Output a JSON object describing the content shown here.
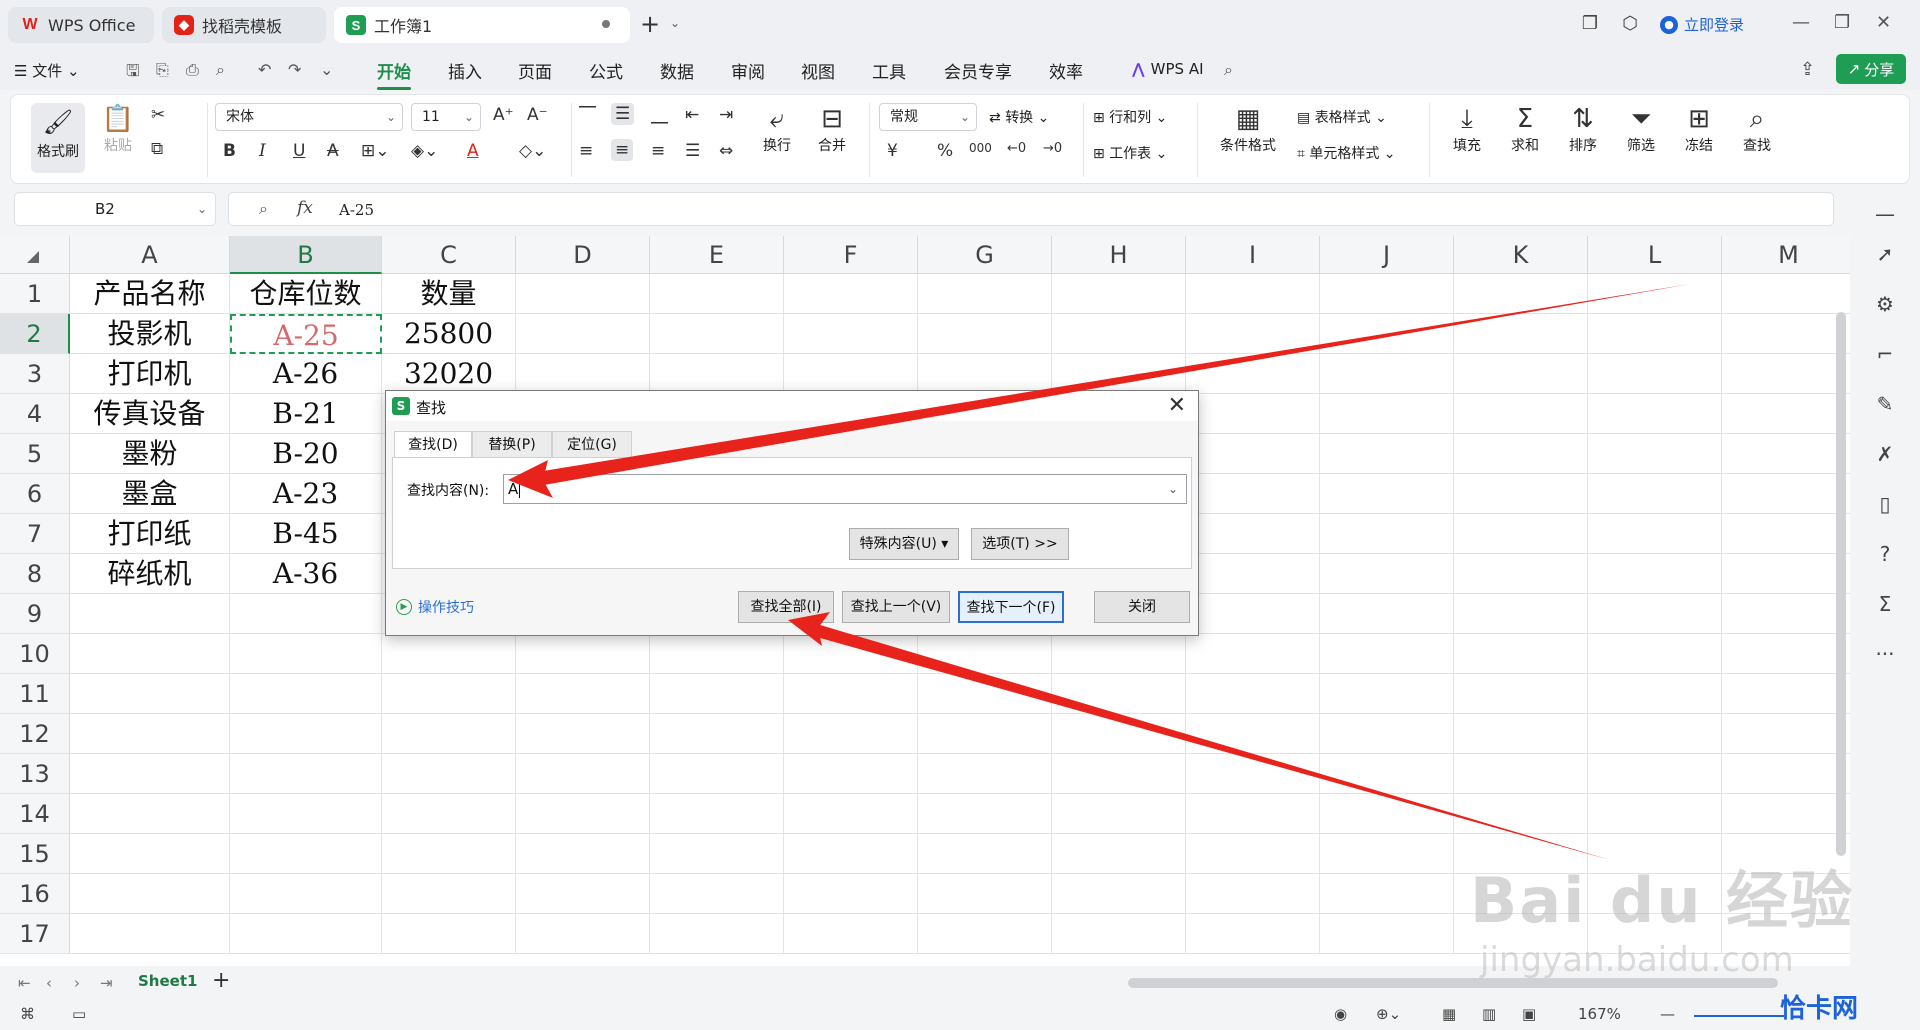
{
  "tabs": {
    "wps": "WPS Office",
    "template": "找稻壳模板",
    "workbook": "工作簿1",
    "wps_logo": "W",
    "sheet_logo": "S"
  },
  "title_bar": {
    "login": "立即登录"
  },
  "menu": {
    "file": "文件",
    "items": [
      "开始",
      "插入",
      "页面",
      "公式",
      "数据",
      "审阅",
      "视图",
      "工具",
      "会员专享",
      "效率"
    ],
    "wps_ai": "WPS AI",
    "share": "分享"
  },
  "ribbon": {
    "format_painter": "格式刷",
    "paste": "粘贴",
    "font_name": "宋体",
    "font_size": "11",
    "wrap": "换行",
    "merge": "合并",
    "number_format": "常规",
    "convert": "转换",
    "row_col": "行和列",
    "worksheet": "工作表",
    "cond_format": "条件格式",
    "table_style": "表格样式",
    "cell_style": "单元格样式",
    "fill": "填充",
    "sum": "求和",
    "sort": "排序",
    "filter": "筛选",
    "freeze": "冻结",
    "find": "查找",
    "bold": "B",
    "italic": "I",
    "underline": "U",
    "font_color": "A",
    "currency": "¥",
    "percent": "%",
    "thousands": "000"
  },
  "formula_bar": {
    "name_box": "B2",
    "fx": "fx",
    "content": "A-25"
  },
  "grid": {
    "columns": [
      "A",
      "B",
      "C",
      "D",
      "E",
      "F",
      "G",
      "H",
      "I",
      "J",
      "K",
      "L",
      "M"
    ],
    "rows": [
      "1",
      "2",
      "3",
      "4",
      "5",
      "6",
      "7",
      "8",
      "9",
      "10",
      "11",
      "12",
      "13",
      "14",
      "15",
      "16",
      "17"
    ],
    "headers": [
      "产品名称",
      "仓库位数",
      "数量"
    ],
    "data": [
      [
        "投影机",
        "A-25",
        "25800"
      ],
      [
        "打印机",
        "A-26",
        "32020"
      ],
      [
        "传真设备",
        "B-21",
        ""
      ],
      [
        "墨粉",
        "B-20",
        ""
      ],
      [
        "墨盒",
        "A-23",
        ""
      ],
      [
        "打印纸",
        "B-45",
        ""
      ],
      [
        "碎纸机",
        "A-36",
        ""
      ]
    ]
  },
  "dialog": {
    "title": "查找",
    "tabs": [
      "查找(D)",
      "替换(P)",
      "定位(G)"
    ],
    "find_label": "查找内容(N):",
    "find_value": "A",
    "special": "特殊内容(U)",
    "options": "选项(T) >>",
    "tips": "操作技巧",
    "find_all": "查找全部(I)",
    "find_prev": "查找上一个(V)",
    "find_next": "查找下一个(F)",
    "close": "关闭"
  },
  "sheets": {
    "active": "Sheet1"
  },
  "status": {
    "zoom": "167%"
  },
  "watermark": {
    "main": "Bai du 经验",
    "sub": "jingyan.baidu.com",
    "corner": "恰卡网"
  },
  "colors": {
    "accent_green": "#1f9d55",
    "annotation_red": "#e8231b",
    "link_blue": "#1e62d8"
  }
}
